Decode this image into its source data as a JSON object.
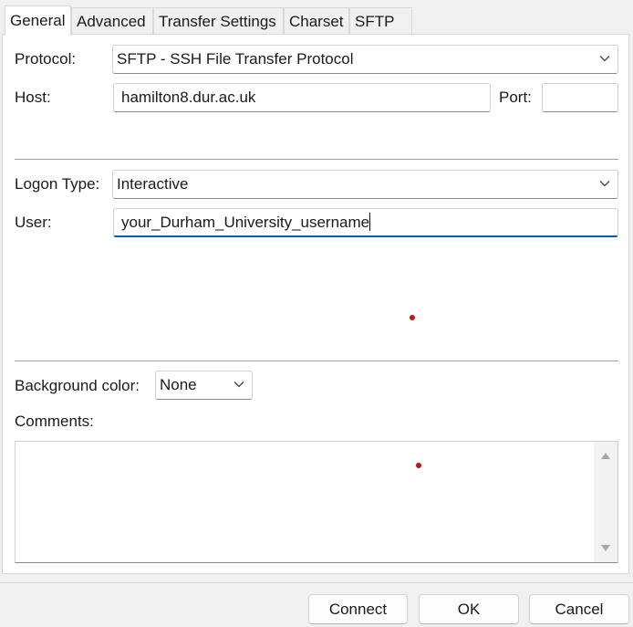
{
  "tabs": [
    {
      "label": "General"
    },
    {
      "label": "Advanced"
    },
    {
      "label": "Transfer Settings"
    },
    {
      "label": "Charset"
    },
    {
      "label": "SFTP"
    }
  ],
  "protocol": {
    "label": "Protocol:",
    "value": "SFTP - SSH File Transfer Protocol"
  },
  "host": {
    "label": "Host:",
    "value": "hamilton8.dur.ac.uk"
  },
  "port": {
    "label": "Port:",
    "value": ""
  },
  "logon_type": {
    "label": "Logon Type:",
    "value": "Interactive"
  },
  "user": {
    "label": "User:",
    "value": "your_Durham_University_username"
  },
  "background_color": {
    "label": "Background color:",
    "value": "None"
  },
  "comments": {
    "label": "Comments:",
    "value": ""
  },
  "buttons": {
    "connect": "Connect",
    "ok": "OK",
    "cancel": "Cancel"
  },
  "colors": {
    "accent": "#005fb8",
    "marker": "#cc1111"
  },
  "icons": [
    "chevron-down-icon",
    "scroll-up-arrow-icon",
    "scroll-down-arrow-icon"
  ]
}
